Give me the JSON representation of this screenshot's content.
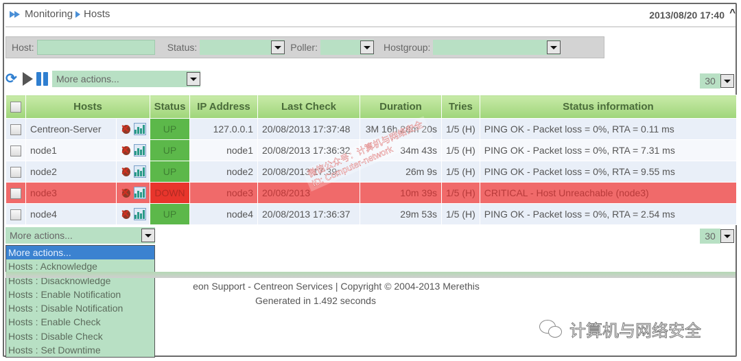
{
  "header": {
    "breadcrumb": [
      "Monitoring",
      "Hosts"
    ],
    "datetime": "2013/08/20 17:40",
    "collapse_icon": "caret-up"
  },
  "filters": {
    "host_label": "Host:",
    "host_value": "",
    "status_label": "Status:",
    "status_value": "",
    "poller_label": "Poller:",
    "poller_value": "",
    "hostgroup_label": "Hostgroup:",
    "hostgroup_value": ""
  },
  "toolbar": {
    "icons": [
      "refresh-icon",
      "play-icon",
      "pause-icon"
    ],
    "actions_select": "More actions...",
    "per_page": "30"
  },
  "table": {
    "columns": [
      "",
      "Hosts",
      "Status",
      "IP Address",
      "Last Check",
      "Duration",
      "Tries",
      "Status information"
    ],
    "rows": [
      {
        "host": "Centreon-Server",
        "status": "UP",
        "ip": "127.0.0.1",
        "last_check": "20/08/2013 17:37:48",
        "duration": "3M 16h 28m 20s",
        "tries": "1/5 (H)",
        "info": "PING OK - Packet loss = 0%, RTA = 0.11 ms"
      },
      {
        "host": "node1",
        "status": "UP",
        "ip": "node1",
        "last_check": "20/08/2013 17:36:32",
        "duration": "34m 43s",
        "tries": "1/5 (H)",
        "info": "PING OK - Packet loss = 0%, RTA = 7.31 ms"
      },
      {
        "host": "node2",
        "status": "UP",
        "ip": "node2",
        "last_check": "20/08/2013 17:39:",
        "duration": "26m 9s",
        "tries": "1/5 (H)",
        "info": "PING OK - Packet loss = 0%, RTA = 9.55 ms"
      },
      {
        "host": "node3",
        "status": "DOWN",
        "ip": "node3",
        "last_check": "20/08/2013",
        "duration": "10m 39s",
        "tries": "1/5 (H)",
        "info": "CRITICAL - Host Unreachable (node3)"
      },
      {
        "host": "node4",
        "status": "UP",
        "ip": "node4",
        "last_check": "20/08/2013 17:36:37",
        "duration": "29m 53s",
        "tries": "1/5 (H)",
        "info": "PING OK - Packet loss = 0%, RTA = 2.54 ms"
      }
    ]
  },
  "bottom": {
    "actions_select": "More actions...",
    "per_page": "30",
    "dropdown_options": [
      "More actions...",
      "Hosts : Acknowledge",
      "Hosts : Disacknowledge",
      "Hosts : Enable Notification",
      "Hosts : Disable Notification",
      "Hosts : Enable Check",
      "Hosts : Disable Check",
      "Hosts : Set Downtime"
    ]
  },
  "footer": {
    "line1": "eon Support - Centreon Services | Copyright © 2004-2013 Merethis",
    "line2": "Generated in 1.492 seconds"
  },
  "watermark": {
    "diagonal_line1": "微信公众号：计算机与网络安全",
    "diagonal_line2": "ID: Computer-network",
    "brand": "计算机与网络安全"
  },
  "colors": {
    "status_up": "#5cb84a",
    "status_down": "#e8352c",
    "row_down": "#f06a6a",
    "header_green": "#9fd57a",
    "input_green": "#b8e0c4",
    "selected_blue": "#3b82d0"
  }
}
